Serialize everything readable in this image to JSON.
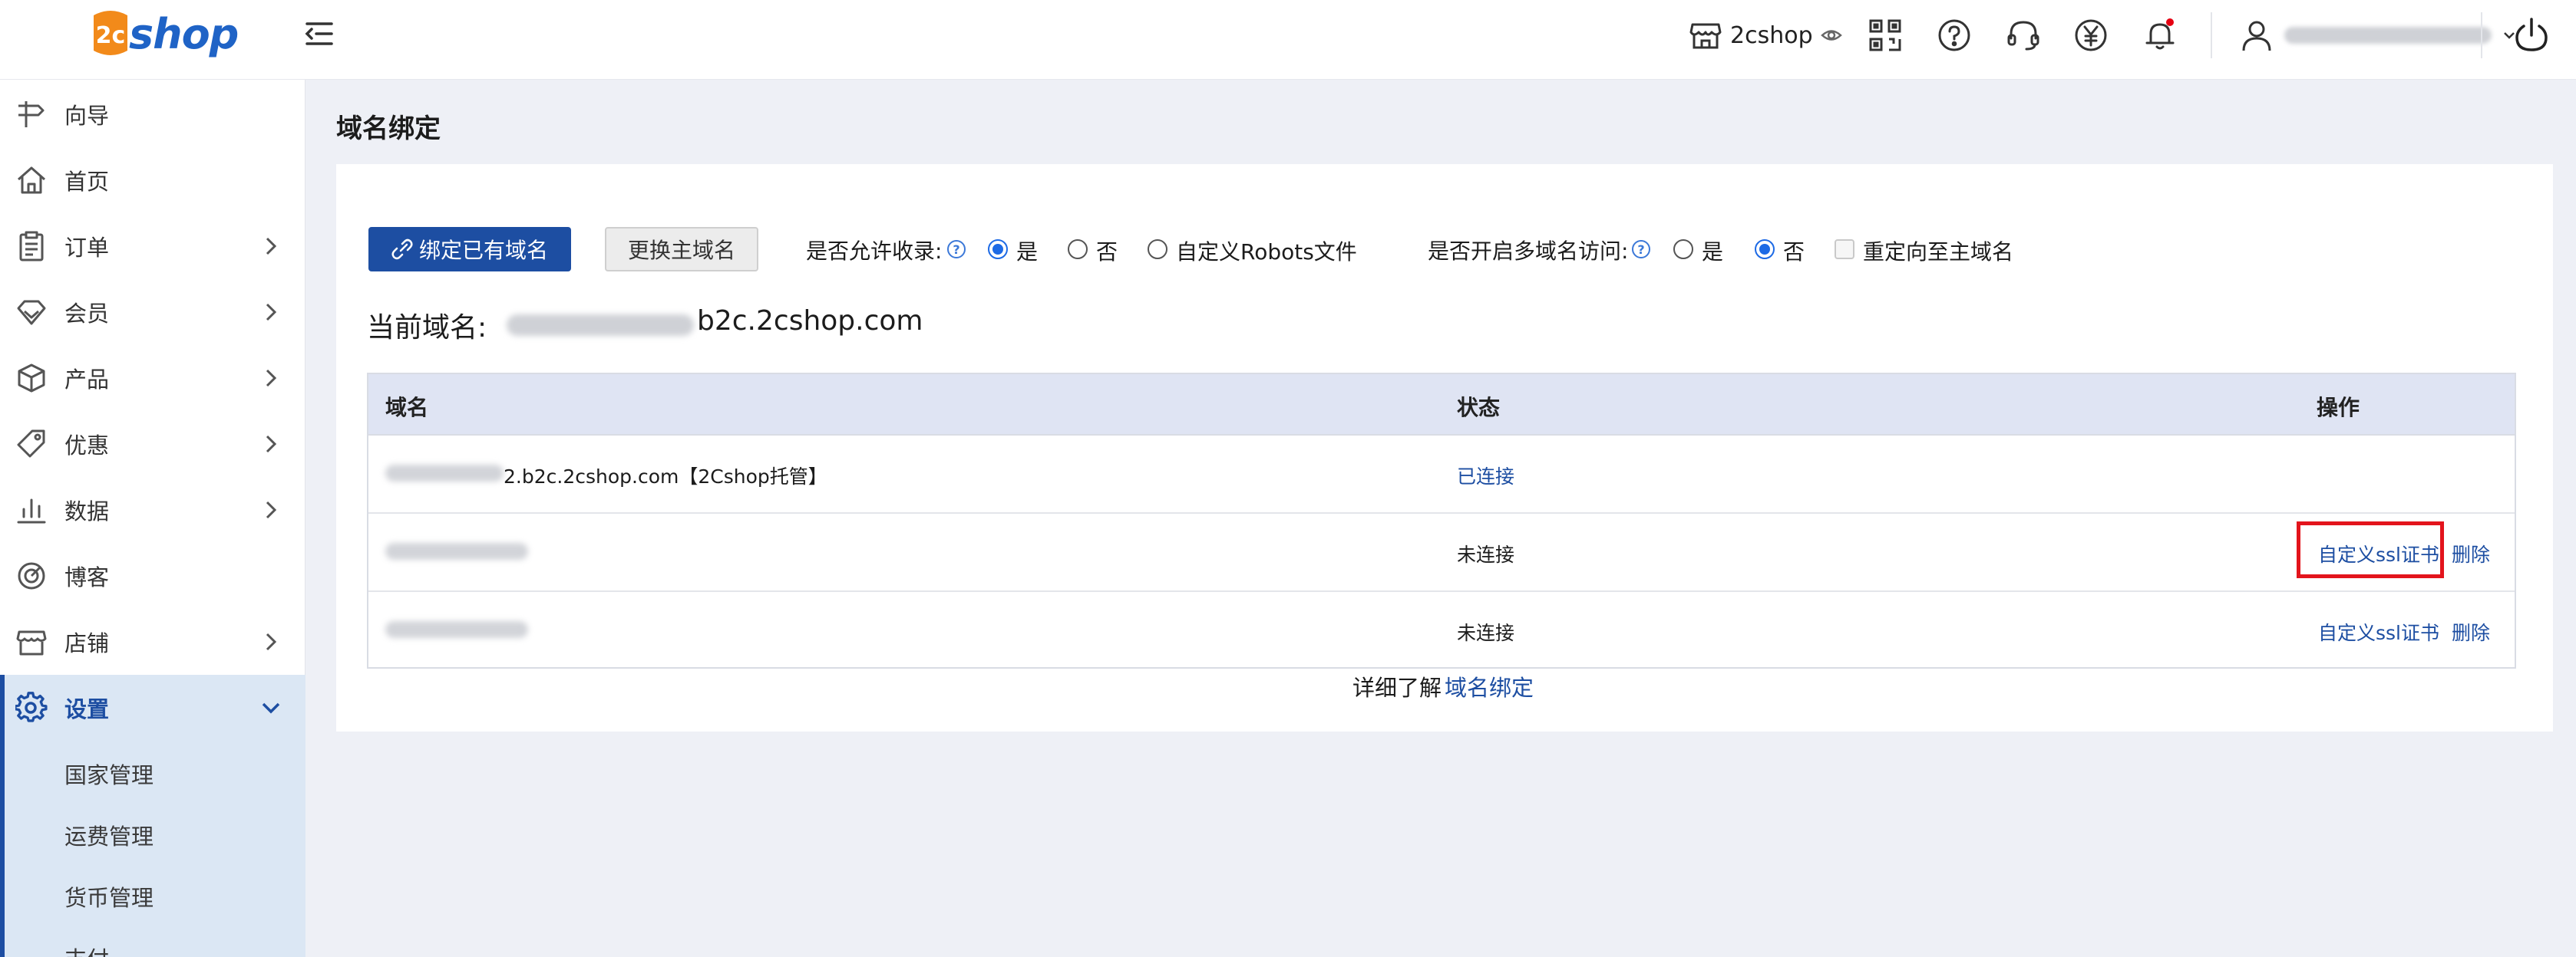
{
  "header": {
    "logo_text": "shop",
    "logo_badge_text": "2c",
    "shop_name": "2cshop",
    "icons": [
      "qr-code-icon",
      "help-icon",
      "headset-icon",
      "yen-icon",
      "bell-icon"
    ]
  },
  "sidebar": {
    "items": [
      {
        "label": "向导",
        "icon": "signpost-icon",
        "has_children": false
      },
      {
        "label": "首页",
        "icon": "home-icon",
        "has_children": false
      },
      {
        "label": "订单",
        "icon": "clipboard-icon",
        "has_children": true
      },
      {
        "label": "会员",
        "icon": "diamond-icon",
        "has_children": true
      },
      {
        "label": "产品",
        "icon": "box-icon",
        "has_children": true
      },
      {
        "label": "优惠",
        "icon": "tag-icon",
        "has_children": true
      },
      {
        "label": "数据",
        "icon": "bar-chart-icon",
        "has_children": true
      },
      {
        "label": "博客",
        "icon": "blog-icon",
        "has_children": false
      },
      {
        "label": "店铺",
        "icon": "store-icon",
        "has_children": true
      },
      {
        "label": "设置",
        "icon": "gear-icon",
        "has_children": true,
        "active": true
      }
    ],
    "sub_items": [
      "国家管理",
      "运费管理",
      "货币管理",
      "支付"
    ]
  },
  "main": {
    "page_title": "域名绑定",
    "bind_button": "绑定已有域名",
    "change_main_button": "更换主域名",
    "allow_index": {
      "label": "是否允许收录:",
      "options": [
        "是",
        "否",
        "自定义Robots文件"
      ],
      "selected": "是"
    },
    "multi_domain": {
      "label": "是否开启多域名访问:",
      "options": [
        "是",
        "否"
      ],
      "selected": "否",
      "redirect_label": "重定向至主域名"
    },
    "current_domain_label": "当前域名:",
    "current_domain_suffix": "b2c.2cshop.com",
    "table": {
      "headers": [
        "域名",
        "状态",
        "操作"
      ],
      "rows": [
        {
          "domain_suffix": "2.b2c.2cshop.com【2Cshop托管】",
          "status": "已连接",
          "status_linked": true,
          "actions": []
        },
        {
          "domain_suffix": "",
          "status": "未连接",
          "status_linked": false,
          "actions": [
            "自定义ssl证书",
            "删除"
          ]
        },
        {
          "domain_suffix": "",
          "status": "未连接",
          "status_linked": false,
          "actions": [
            "自定义ssl证书",
            "删除"
          ]
        }
      ]
    },
    "footer_text": "详细了解",
    "footer_link": "域名绑定"
  },
  "colors": {
    "primary": "#1d4ea2",
    "accent_blue": "#1f63c6",
    "logo_orange": "#f28a1a",
    "highlight_red": "#e3141c",
    "notification_red": "#e60012",
    "sidebar_active_bg": "#dbe7f4"
  }
}
